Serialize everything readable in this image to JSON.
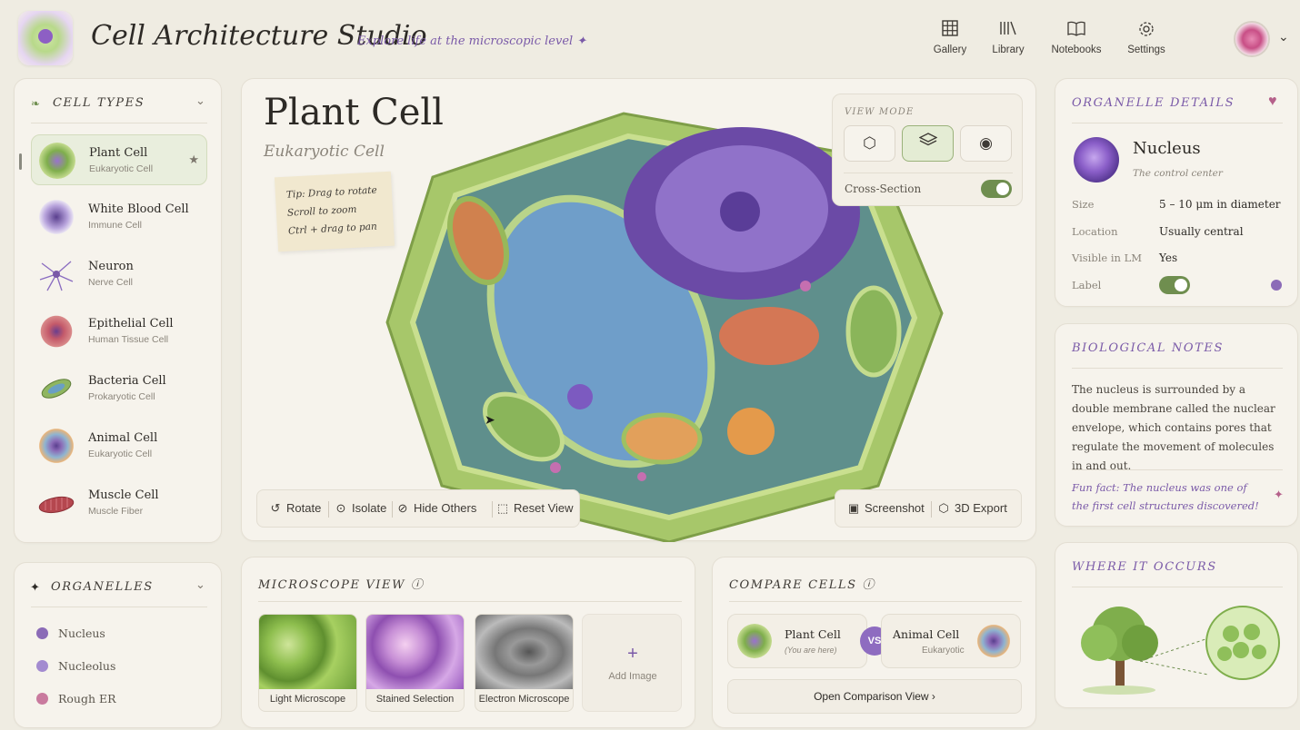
{
  "header": {
    "app_title": "Cell Architecture Studio",
    "tagline": "Explore life at the microscopic level ✦",
    "nav": [
      {
        "label": "Gallery",
        "icon": "grid-icon"
      },
      {
        "label": "Library",
        "icon": "library-icon"
      },
      {
        "label": "Notebooks",
        "icon": "book-icon"
      },
      {
        "label": "Settings",
        "icon": "gear-icon"
      }
    ]
  },
  "cell_types": {
    "title": "CELL TYPES",
    "items": [
      {
        "name": "Plant Cell",
        "sub": "Eukaryotic Cell",
        "active": true
      },
      {
        "name": "White Blood Cell",
        "sub": "Immune Cell"
      },
      {
        "name": "Neuron",
        "sub": "Nerve Cell"
      },
      {
        "name": "Epithelial Cell",
        "sub": "Human Tissue Cell"
      },
      {
        "name": "Bacteria Cell",
        "sub": "Prokaryotic Cell"
      },
      {
        "name": "Animal Cell",
        "sub": "Eukaryotic Cell"
      },
      {
        "name": "Muscle Cell",
        "sub": "Muscle Fiber"
      }
    ]
  },
  "organelles": {
    "title": "ORGANELLES",
    "items": [
      {
        "name": "Nucleus",
        "color": "#8b6bb7"
      },
      {
        "name": "Nucleolus",
        "color": "#a38bd0"
      },
      {
        "name": "Rough ER",
        "color": "#c97a9e"
      }
    ]
  },
  "viewer": {
    "title": "Plant Cell",
    "subtitle": "Eukaryotic Cell",
    "tip": [
      "Tip: Drag to rotate",
      "Scroll to zoom",
      "Ctrl + drag to pan"
    ],
    "view_mode_label": "VIEW MODE",
    "cross_section_label": "Cross-Section",
    "cross_section_on": true,
    "tools": [
      "Rotate",
      "Isolate",
      "Hide Others",
      "Reset View"
    ],
    "actions": [
      "Screenshot",
      "3D Export"
    ]
  },
  "microscope": {
    "title": "MICROSCOPE VIEW",
    "images": [
      "Light Microscope",
      "Stained Selection",
      "Electron Microscope"
    ],
    "add_label": "Add Image"
  },
  "compare": {
    "title": "COMPARE CELLS",
    "left": {
      "name": "Plant Cell",
      "sub": "(You are here)"
    },
    "vs": "VS",
    "right": {
      "name": "Animal Cell",
      "sub": "Eukaryotic"
    },
    "open_label": "Open Comparison View ›"
  },
  "details": {
    "title": "ORGANELLE DETAILS",
    "name": "Nucleus",
    "sub": "The control center",
    "rows": [
      {
        "key": "Size",
        "value": "5 – 10 μm in diameter"
      },
      {
        "key": "Location",
        "value": "Usually central"
      },
      {
        "key": "Visible in LM",
        "value": "Yes"
      },
      {
        "key": "Label",
        "value": ""
      }
    ],
    "label_on": true
  },
  "notes": {
    "title": "BIOLOGICAL NOTES",
    "body": "The nucleus is surrounded by a double membrane called the nuclear envelope, which contains pores that regulate the movement of molecules in and out.",
    "fun_fact": "Fun fact: The nucleus was one of the first cell structures discovered!"
  },
  "occurs": {
    "title": "WHERE IT OCCURS"
  },
  "colors": {
    "accent": "#7a5aa8",
    "green": "#6f8e4f",
    "background": "#efece2"
  }
}
